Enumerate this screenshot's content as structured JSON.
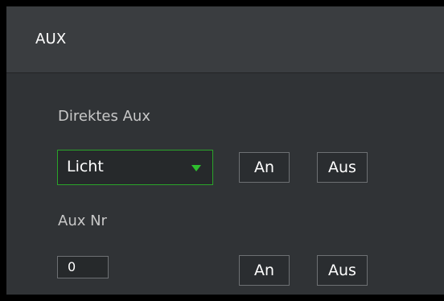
{
  "panel": {
    "title": "AUX"
  },
  "direct_aux": {
    "label": "Direktes Aux",
    "select_value": "Licht",
    "on_label": "An",
    "off_label": "Aus"
  },
  "aux_nr": {
    "label": "Aux Nr",
    "value": "0",
    "on_label": "An",
    "off_label": "Aus"
  },
  "colors": {
    "panel_bg": "#303336",
    "header_bg": "#3a3d40",
    "accent_green": "#2aa42a",
    "text": "#ffffff",
    "label_text": "#c8c8c8"
  },
  "icons": {
    "select_arrow": "chevron-down-icon"
  }
}
